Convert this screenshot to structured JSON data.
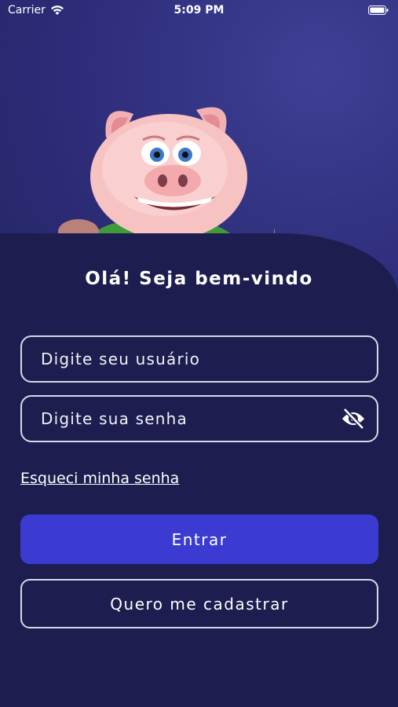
{
  "status_bar": {
    "carrier": "Carrier",
    "time": "5:09 PM"
  },
  "mascot": {
    "description_icon": "pig-mascot-icon"
  },
  "login": {
    "greeting": "Olá! Seja bem-vindo",
    "username_placeholder": "Digite seu usuário",
    "password_placeholder": "Digite sua senha",
    "forgot_password": "Esqueci minha senha",
    "login_button": "Entrar",
    "register_button": "Quero me cadastrar"
  },
  "colors": {
    "background": "#1d1d4f",
    "primary": "#3b3bd2",
    "border": "#d8d8e8"
  }
}
